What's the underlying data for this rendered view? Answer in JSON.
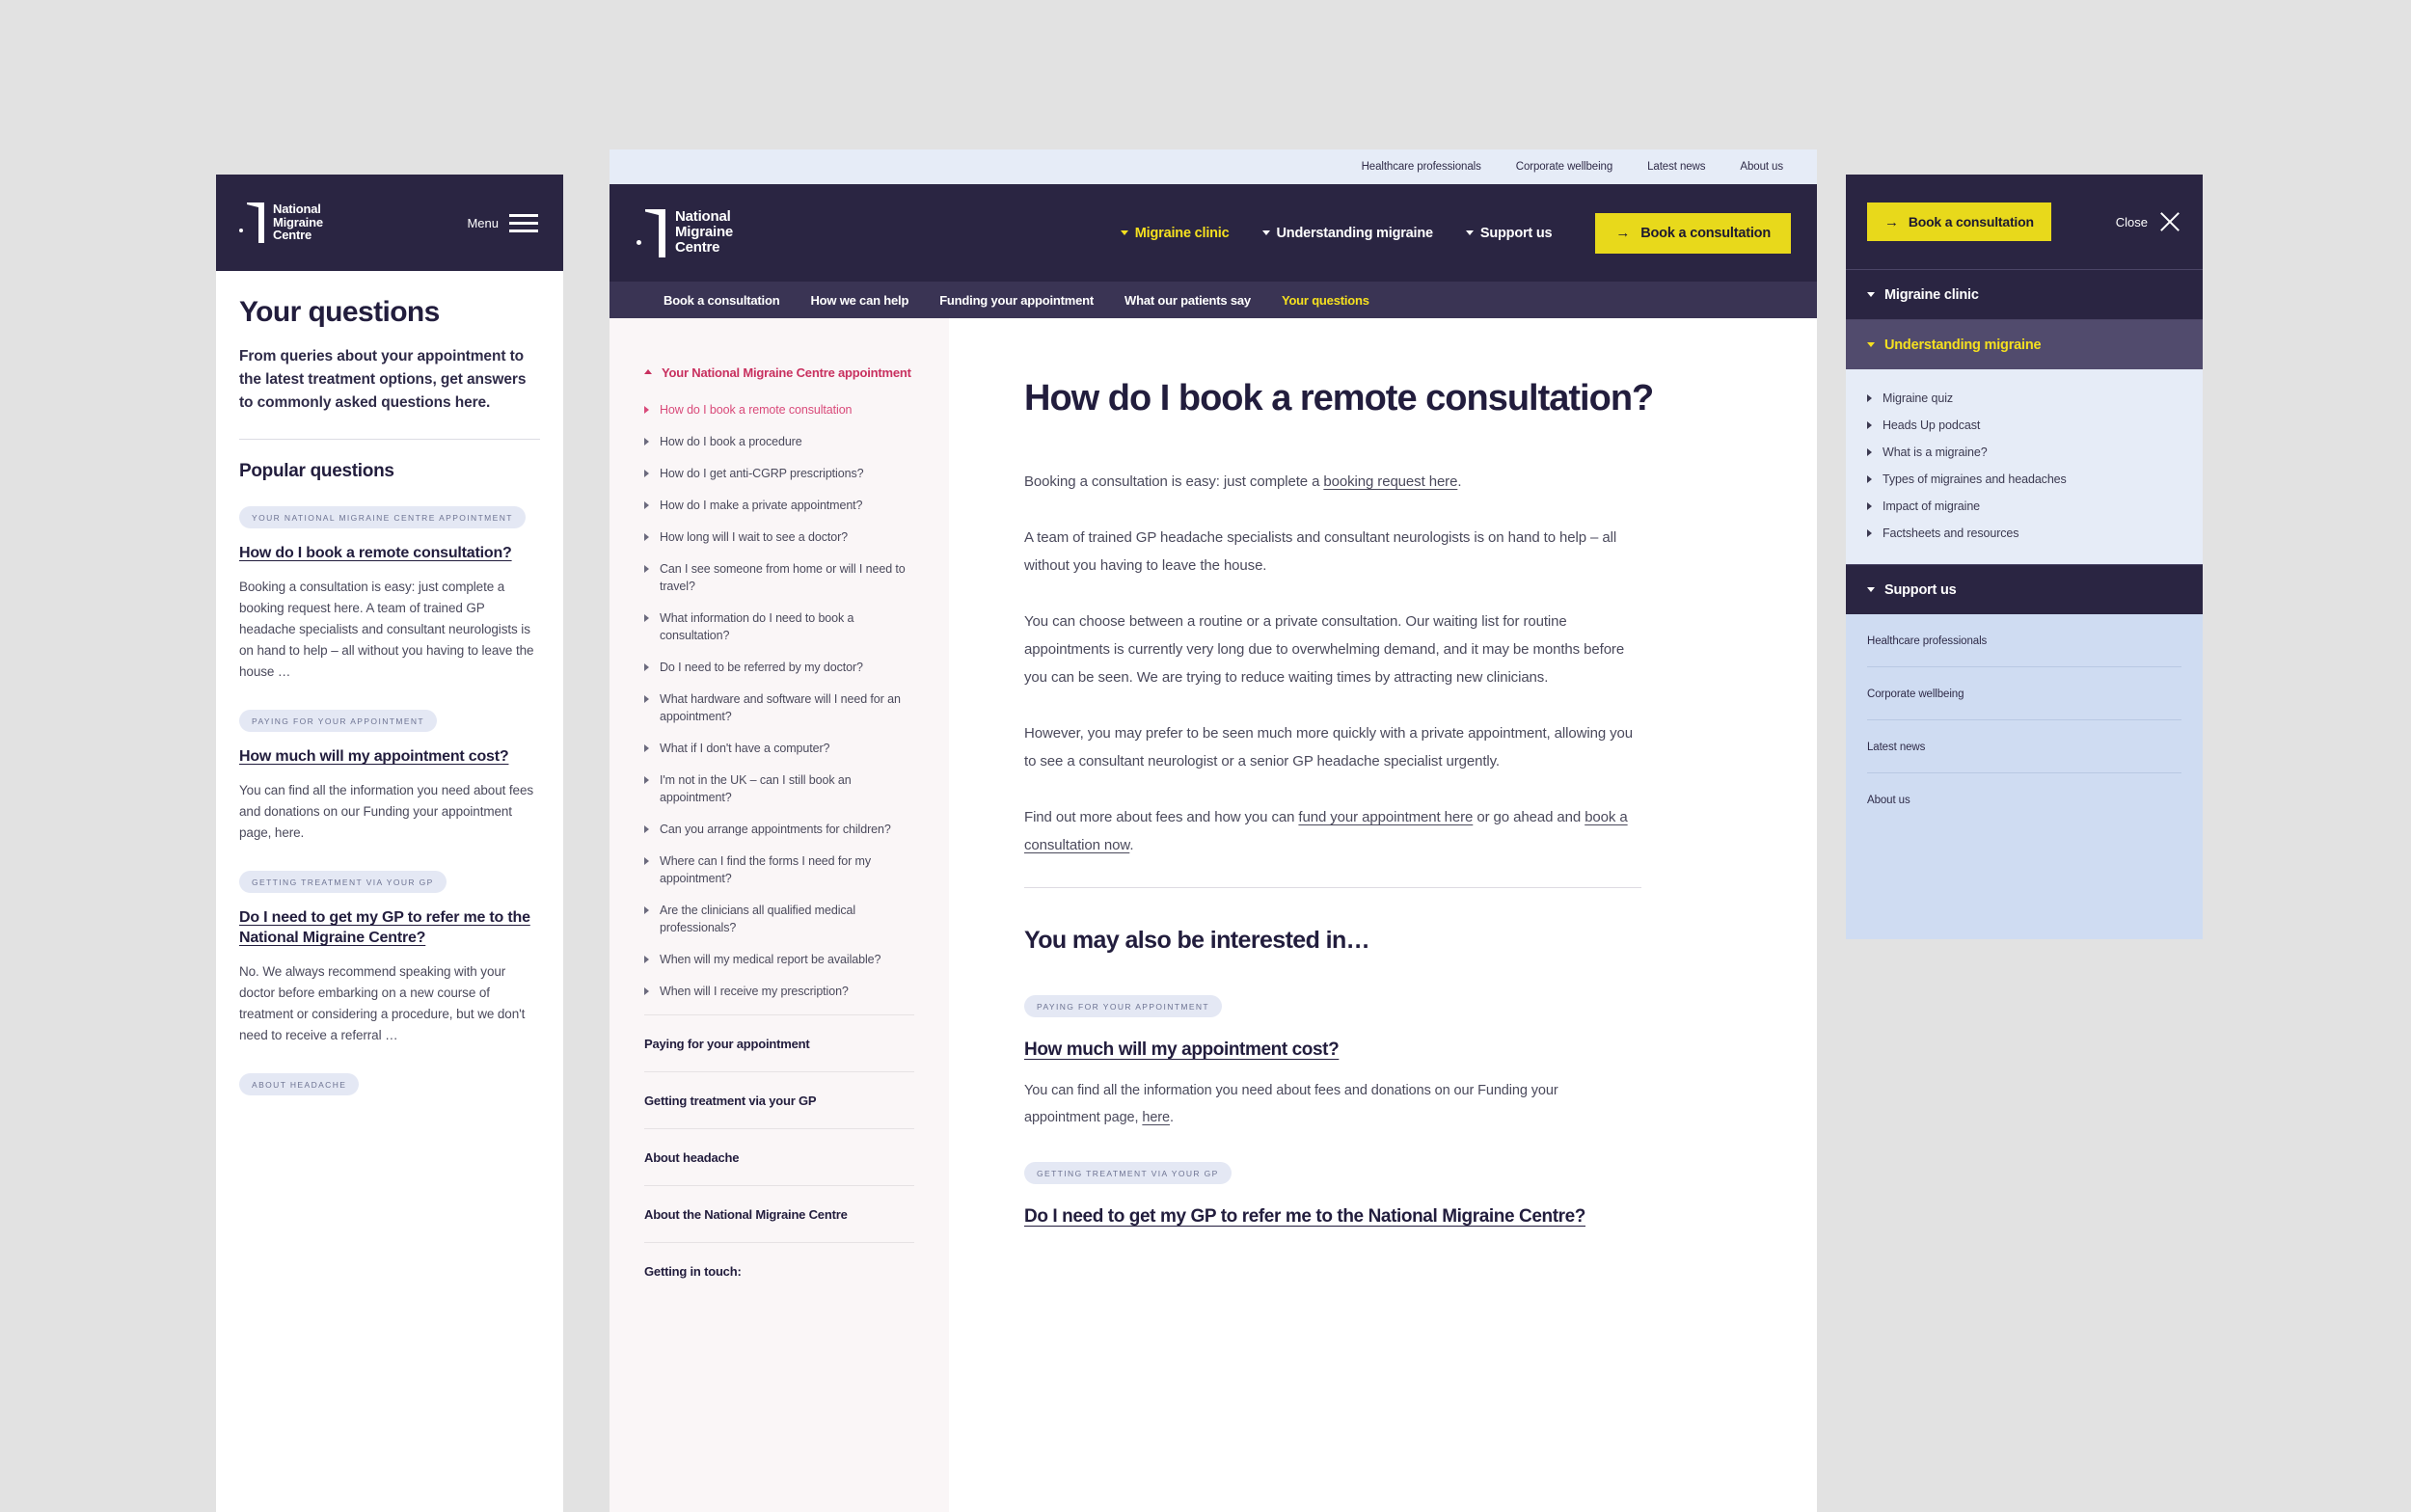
{
  "brand": {
    "name_lines": [
      "National",
      "Migraine",
      "Centre"
    ],
    "accent_yellow": "#e8d91b",
    "dark_navy": "#2a2542",
    "pink_accent": "#c8305f"
  },
  "mobile_page": {
    "menu_label": "Menu",
    "title": "Your questions",
    "intro": "From queries about your appointment to the latest treatment options, get answers to commonly asked questions here.",
    "section_heading": "Popular questions",
    "questions": [
      {
        "tag": "Your National Migraine Centre appointment",
        "title": "How do I book a remote consultation?",
        "body": "Booking a consultation is easy: just complete a booking request here.\nA team of trained GP headache specialists and consultant neurologists is on hand to help – all without you having to leave the house …"
      },
      {
        "tag": "Paying for your appointment",
        "title": "How much will my appointment cost?",
        "body": "You can find all the information you need about fees and donations on our Funding your appointment page, here."
      },
      {
        "tag": "Getting treatment via your GP",
        "title": "Do I need to get my GP to refer me to the National Migraine Centre?",
        "body": "No. We always recommend speaking with your doctor before embarking on a new course of treatment or considering a procedure, but we don't need to receive a referral …"
      },
      {
        "tag": "About headache",
        "title": "",
        "body": ""
      }
    ]
  },
  "desktop": {
    "utility_links": [
      "Healthcare professionals",
      "Corporate wellbeing",
      "Latest news",
      "About us"
    ],
    "main_nav": [
      {
        "label": "Migraine clinic",
        "active": true
      },
      {
        "label": "Understanding migraine",
        "active": false
      },
      {
        "label": "Support us",
        "active": false
      }
    ],
    "book_button": "Book a consultation",
    "sub_nav": [
      {
        "label": "Book a consultation",
        "active": false
      },
      {
        "label": "How we can help",
        "active": false
      },
      {
        "label": "Funding your appointment",
        "active": false
      },
      {
        "label": "What our patients say",
        "active": false
      },
      {
        "label": "Your questions",
        "active": true
      }
    ],
    "sidebar": {
      "group_title": "Your National Migraine Centre appointment",
      "questions": [
        {
          "label": "How do I book a remote consultation",
          "current": true
        },
        {
          "label": "How do I book a procedure",
          "current": false
        },
        {
          "label": "How do I get anti-CGRP prescriptions?",
          "current": false
        },
        {
          "label": "How do I make a private appointment?",
          "current": false
        },
        {
          "label": "How long will I wait to see a doctor?",
          "current": false
        },
        {
          "label": "Can I see someone from home or will I need to travel?",
          "current": false
        },
        {
          "label": "What information do I need to book a consultation?",
          "current": false
        },
        {
          "label": "Do I need to be referred by my doctor?",
          "current": false
        },
        {
          "label": "What hardware and software will I need for an appointment?",
          "current": false
        },
        {
          "label": "What if I don't have a computer?",
          "current": false
        },
        {
          "label": "I'm not in the UK – can I still book an appointment?",
          "current": false
        },
        {
          "label": "Can you arrange appointments for children?",
          "current": false
        },
        {
          "label": "Where can I find the forms I need for my appointment?",
          "current": false
        },
        {
          "label": "Are the clinicians all qualified medical professionals?",
          "current": false
        },
        {
          "label": "When will my medical report be available?",
          "current": false
        },
        {
          "label": "When will I receive my prescription?",
          "current": false
        }
      ],
      "categories": [
        "Paying for your appointment",
        "Getting treatment via your GP",
        "About headache",
        "About the National Migraine Centre",
        "Getting in touch:"
      ]
    },
    "article": {
      "title": "How do I book a remote consultation?",
      "paragraphs": [
        {
          "before": "Booking a consultation is easy: just complete a ",
          "link": "booking request here",
          "after": "."
        },
        {
          "before": "A team of trained GP headache specialists and consultant neurologists is on hand to help – all without you having to leave the house.",
          "link": "",
          "after": ""
        },
        {
          "before": "You can choose between a routine or a private consultation. Our waiting list for routine appointments is currently very long due to overwhelming demand, and it may be months before you can be seen. We are trying to reduce waiting times by attracting new clinicians.",
          "link": "",
          "after": ""
        },
        {
          "before": "However, you may prefer to be seen much more quickly with a private appointment, allowing you to see a consultant neurologist or a senior GP headache specialist urgently.",
          "link": "",
          "after": ""
        },
        {
          "before": "Find out more about fees and how you can ",
          "link": "fund your appointment here",
          "after": " or go ahead and ",
          "link2": "book a consultation now",
          "after2": "."
        }
      ]
    },
    "also": {
      "heading": "You may also be interested in…",
      "items": [
        {
          "tag": "Paying for your appointment",
          "question": "How much will my appointment cost?",
          "body_before": "You can find all the information you need about fees and donations on our Funding your appointment page, ",
          "body_link": "here",
          "body_after": "."
        },
        {
          "tag": "Getting treatment via your GP",
          "question": "Do I need to get my GP to refer me to the National Migraine Centre?",
          "body_before": "",
          "body_link": "",
          "body_after": ""
        }
      ]
    }
  },
  "mobile_menu": {
    "book_button": "Book a consultation",
    "close_label": "Close",
    "rows": [
      {
        "label": "Migraine clinic",
        "open": false
      },
      {
        "label": "Understanding migraine",
        "open": true
      }
    ],
    "understanding_items": [
      "Migraine quiz",
      "Heads Up podcast",
      "What is a migraine?",
      "Types of migraines and headaches",
      "Impact of migraine",
      "Factsheets and resources"
    ],
    "support_row": {
      "label": "Support us",
      "open": false
    },
    "links": [
      "Healthcare professionals",
      "Corporate wellbeing",
      "Latest news",
      "About us"
    ]
  }
}
